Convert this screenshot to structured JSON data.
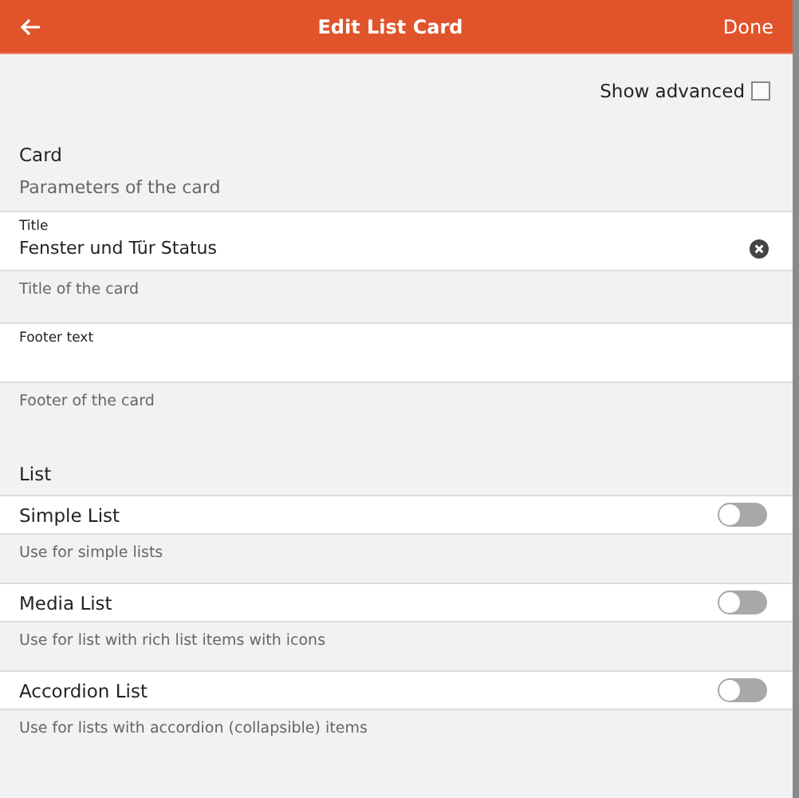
{
  "header": {
    "title": "Edit List Card",
    "done": "Done"
  },
  "show_advanced": {
    "label": "Show advanced",
    "checked": false
  },
  "card_section": {
    "title": "Card",
    "description": "Parameters of the card"
  },
  "fields": [
    {
      "label": "Title",
      "value": "Fenster und Tür Status",
      "clearable": true,
      "hint": "Title of the card"
    },
    {
      "label": "Footer text",
      "clearable": false,
      "hint": "Footer of the card"
    }
  ],
  "list_section": {
    "title": "List"
  },
  "toggles": [
    {
      "label": "Simple List",
      "on": false,
      "hint": "Use for simple lists"
    },
    {
      "label": "Media List",
      "on": false,
      "hint": "Use for list with rich list items with icons"
    },
    {
      "label": "Accordion List",
      "on": false,
      "hint": "Use for lists with accordion (collapsible) items"
    }
  ]
}
